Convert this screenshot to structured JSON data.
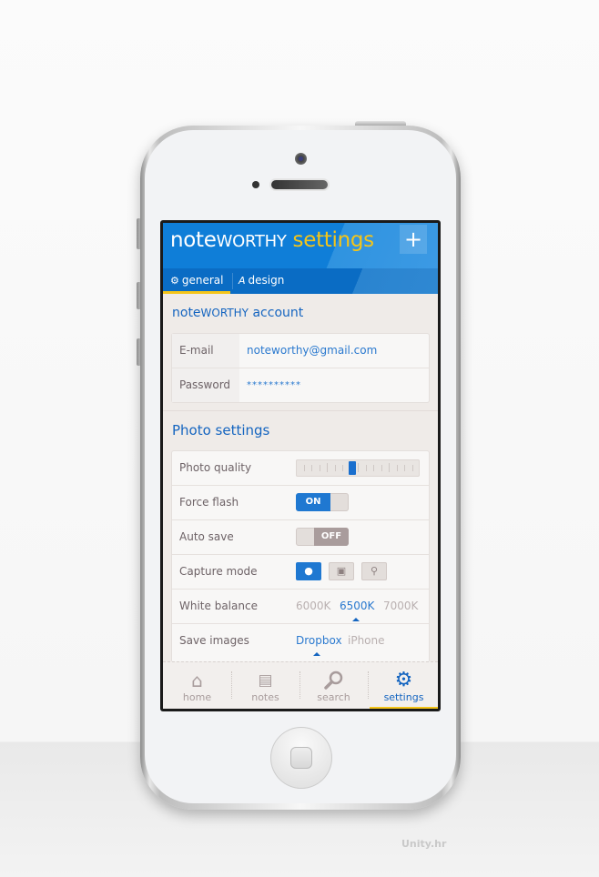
{
  "app": {
    "brand_lower": "note",
    "brand_caps": "WORTHY",
    "screen_title": "settings",
    "add_button": "+",
    "accent_color": "#f5c518",
    "primary_color": "#0f7ed8"
  },
  "tabs": [
    {
      "label": "general",
      "icon": "gears-icon",
      "glyph": "⚙",
      "active": true
    },
    {
      "label": "design",
      "icon": "font-icon",
      "glyph": "A",
      "active": false
    }
  ],
  "account": {
    "section_title_lower": "note",
    "section_title_caps": "WORTHY",
    "section_title_rest": " account",
    "rows": [
      {
        "label": "E-mail",
        "value": "noteworthy@gmail.com"
      },
      {
        "label": "Password",
        "value": "**********"
      }
    ]
  },
  "photo": {
    "section_title": "Photo settings",
    "photo_quality": {
      "label": "Photo quality",
      "value_fraction": 0.45
    },
    "force_flash": {
      "label": "Force flash",
      "state": "ON"
    },
    "auto_save": {
      "label": "Auto save",
      "state": "OFF"
    },
    "capture_mode": {
      "label": "Capture mode",
      "options": [
        {
          "icon": "person-icon",
          "glyph": "👤",
          "active": true
        },
        {
          "icon": "landscape-icon",
          "glyph": "▣",
          "active": false
        },
        {
          "icon": "lightbulb-icon",
          "glyph": "💡",
          "active": false
        }
      ]
    },
    "white_balance": {
      "label": "White balance",
      "options": [
        "6000K",
        "6500K",
        "7000K"
      ],
      "selected": "6500K"
    },
    "save_images": {
      "label": "Save images",
      "options": [
        "Dropbox",
        "iPhone"
      ],
      "selected": "Dropbox"
    }
  },
  "bottom_nav": [
    {
      "label": "home",
      "icon": "home-icon",
      "glyph": "⌂",
      "active": false
    },
    {
      "label": "notes",
      "icon": "clipboard-icon",
      "glyph": "📋",
      "active": false
    },
    {
      "label": "search",
      "icon": "search-icon",
      "glyph": "⚲",
      "active": false
    },
    {
      "label": "settings",
      "icon": "gear-icon",
      "glyph": "⚙",
      "active": true
    }
  ],
  "watermark": "Unity.hr"
}
